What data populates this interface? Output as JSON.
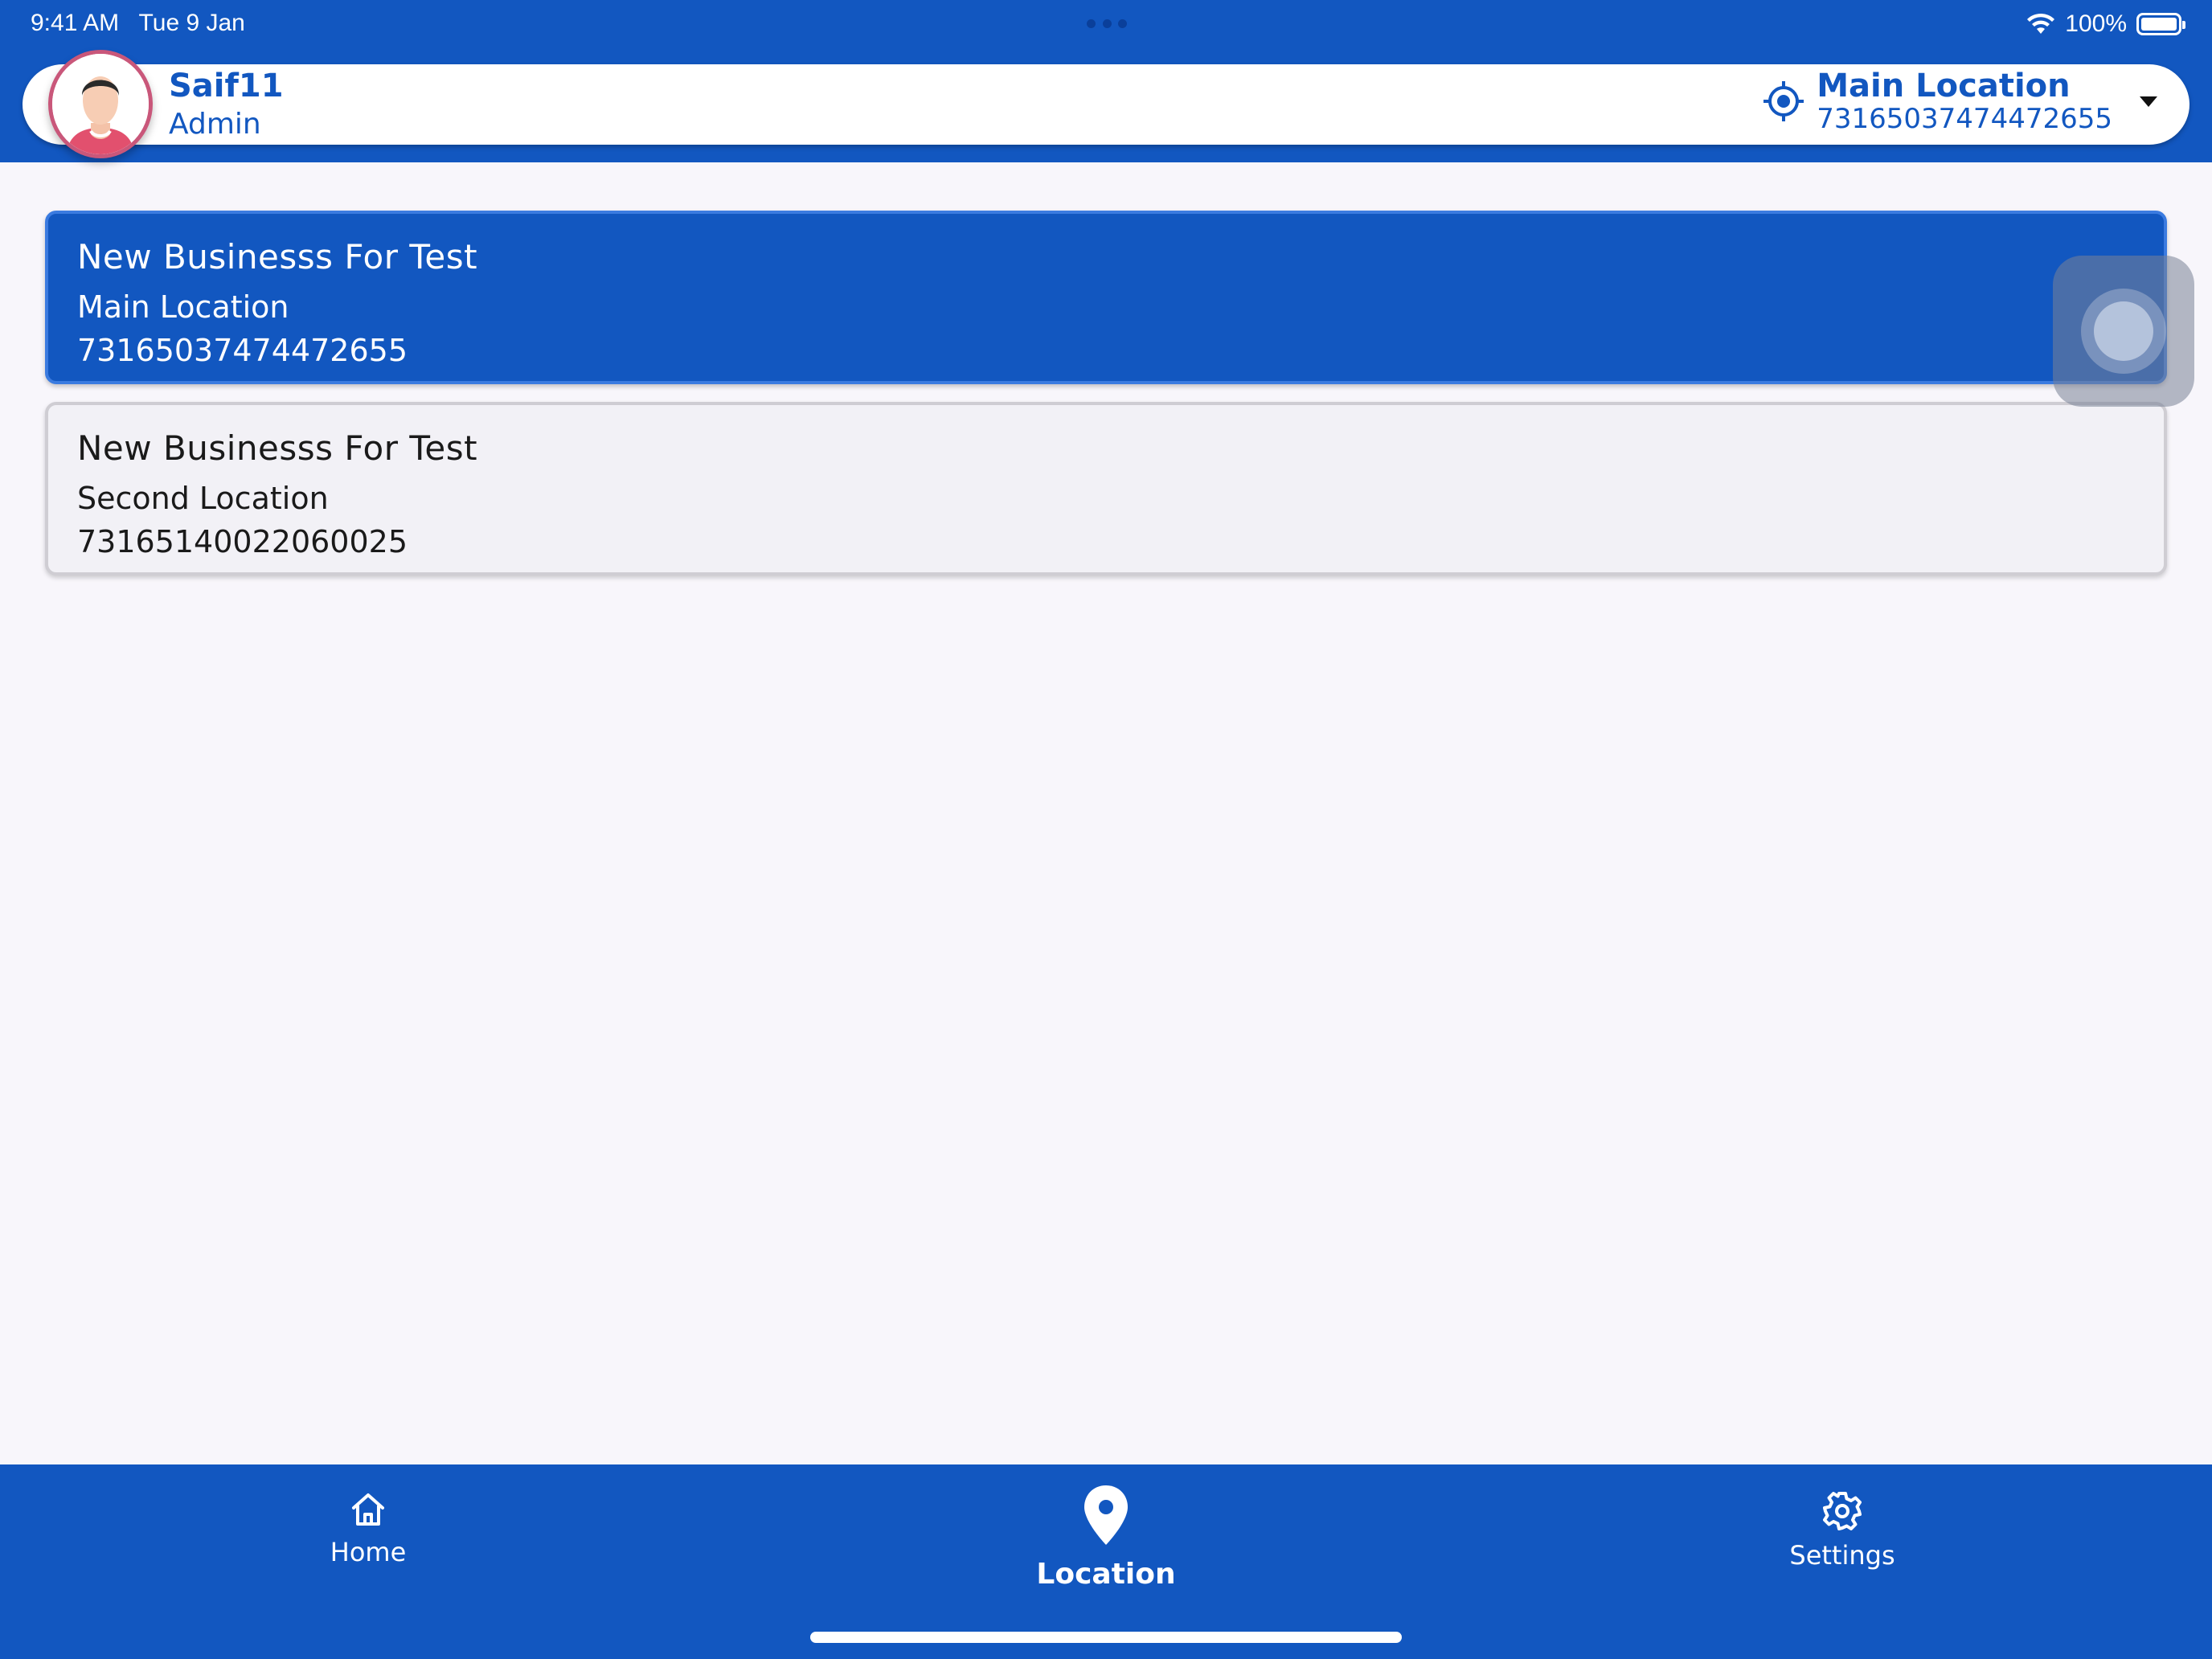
{
  "status_bar": {
    "time": "9:41 AM",
    "date": "Tue 9 Jan",
    "battery": "100%",
    "wifi_icon": "wifi-icon",
    "battery_icon": "battery-icon"
  },
  "header": {
    "user_name": "Saif11",
    "user_role": "Admin",
    "current_location": {
      "name": "Main Location",
      "id": "73165037474472655"
    }
  },
  "locations": [
    {
      "business": "New Businesss For Test",
      "name": "Main Location",
      "id": "73165037474472655",
      "selected": true
    },
    {
      "business": "New Businesss For Test",
      "name": "Second Location",
      "id": "73165140022060025",
      "selected": false
    }
  ],
  "bottom_nav": {
    "items": [
      {
        "label": "Home",
        "icon": "home-icon",
        "active": false
      },
      {
        "label": "Location",
        "icon": "location-pin-icon",
        "active": true
      },
      {
        "label": "Settings",
        "icon": "gear-icon",
        "active": false
      }
    ]
  },
  "colors": {
    "primary": "#1257c0",
    "background": "#f8f6fb",
    "card": "#f2f1f6",
    "avatar_border": "#c9577a"
  }
}
